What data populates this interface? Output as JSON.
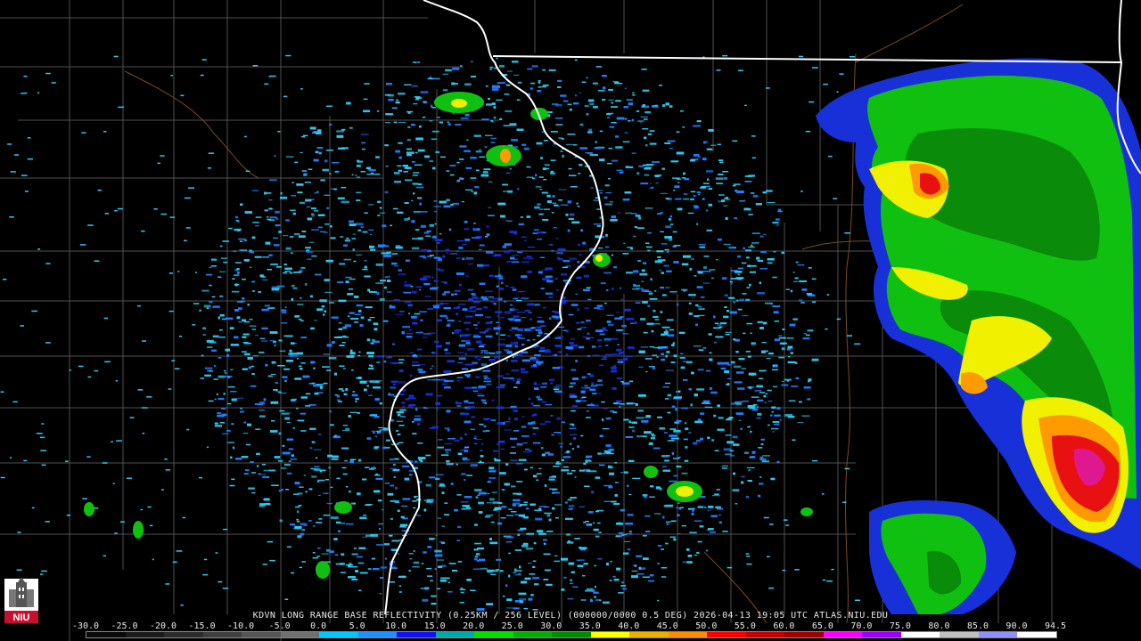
{
  "product_title": "KDVN LONG RANGE BASE REFLECTIVITY (0.25KM / 256 LEVEL) (000000/0000 0.5 DEG) 2026-04-13 19:05 UTC  ATLAS.NIU.EDU",
  "logo": {
    "text": "NIU",
    "icon": "university-tower-icon"
  },
  "scale": {
    "labels": [
      "-30.0",
      "-25.0",
      "-20.0",
      "-15.0",
      "-10.0",
      "-5.0",
      "0.0",
      "5.0",
      "10.0",
      "15.0",
      "20.0",
      "25.0",
      "30.0",
      "35.0",
      "40.0",
      "45.0",
      "50.0",
      "55.0",
      "60.0",
      "65.0",
      "70.0",
      "75.0",
      "80.0",
      "85.0",
      "90.0",
      "94.5"
    ],
    "colors": [
      "#0a0a0a",
      "#1a1a1a",
      "#2c2c2c",
      "#3f3f3f",
      "#555555",
      "#6f6f6f",
      "#00c8ff",
      "#1e90ff",
      "#1010ff",
      "#00a8a8",
      "#00e000",
      "#00b000",
      "#008c00",
      "#ffff00",
      "#e8b000",
      "#ff8c00",
      "#ff0000",
      "#c80000",
      "#a00000",
      "#ff00ff",
      "#a000ff",
      "#ffffff",
      "#c0c0c0",
      "#9090ff",
      "#ffffff"
    ]
  },
  "colors": {
    "background": "#000000",
    "state_border": "#ffffff",
    "county_line": "#5a5a5a",
    "river_line": "#7a4a2a",
    "clutter_light": "#2ec8f0",
    "clutter_mid": "#1e80ff",
    "clutter_dark": "#1830d8",
    "precip_green": "#10c010",
    "precip_dark_green": "#0a8c0a",
    "precip_yellow": "#f0f000",
    "precip_orange": "#ff9a00",
    "precip_red": "#e81010",
    "precip_magenta": "#e01890"
  }
}
